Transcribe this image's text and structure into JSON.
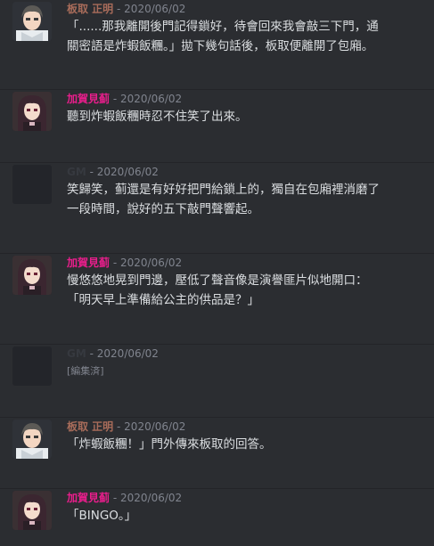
{
  "messages": [
    {
      "author": "板取 正明",
      "author_color": "#a86c5a",
      "timestamp": "2020/06/02",
      "avatar": "boy-avatar",
      "lines": [
        "「......那我離開後門記得鎖好，待會回來我會敲三下門，通",
        "關密語是炸蝦飯糰。」拋下幾句話後，板取便離開了包廂。"
      ]
    },
    {
      "author": "加賀見蓟",
      "author_color": "#e91e8c",
      "timestamp": "2020/06/02",
      "avatar": "girl-avatar",
      "lines": [
        "聽到炸蝦飯糰時忍不住笑了出來。"
      ]
    },
    {
      "author": "GM",
      "author_color": "#36393f",
      "timestamp": "2020/06/02",
      "avatar": "blank-avatar",
      "lines": [
        "笑歸笑，蓟還是有好好把門給鎖上的，獨自在包廂裡消磨了",
        "一段時間，說好的五下敲門聲響起。"
      ]
    },
    {
      "author": "加賀見蓟",
      "author_color": "#e91e8c",
      "timestamp": "2020/06/02",
      "avatar": "girl-avatar",
      "lines": [
        "慢悠悠地晃到門邊，壓低了聲音像是演譽匪片似地開口：",
        "「明天早上準備給公主的供品是？」"
      ]
    },
    {
      "author": "GM",
      "author_color": "#36393f",
      "timestamp": "2020/06/02",
      "avatar": "blank-avatar",
      "edited": "[編集済]",
      "lines": []
    },
    {
      "author": "板取 正明",
      "author_color": "#a86c5a",
      "timestamp": "2020/06/02",
      "avatar": "boy-avatar",
      "lines": [
        "「炸蝦飯糰！」門外傳來板取的回答。"
      ]
    },
    {
      "author": "加賀見蓟",
      "author_color": "#e91e8c",
      "timestamp": "2020/06/02",
      "avatar": "girl-avatar",
      "lines": [
        "「BINGO。」"
      ]
    }
  ]
}
